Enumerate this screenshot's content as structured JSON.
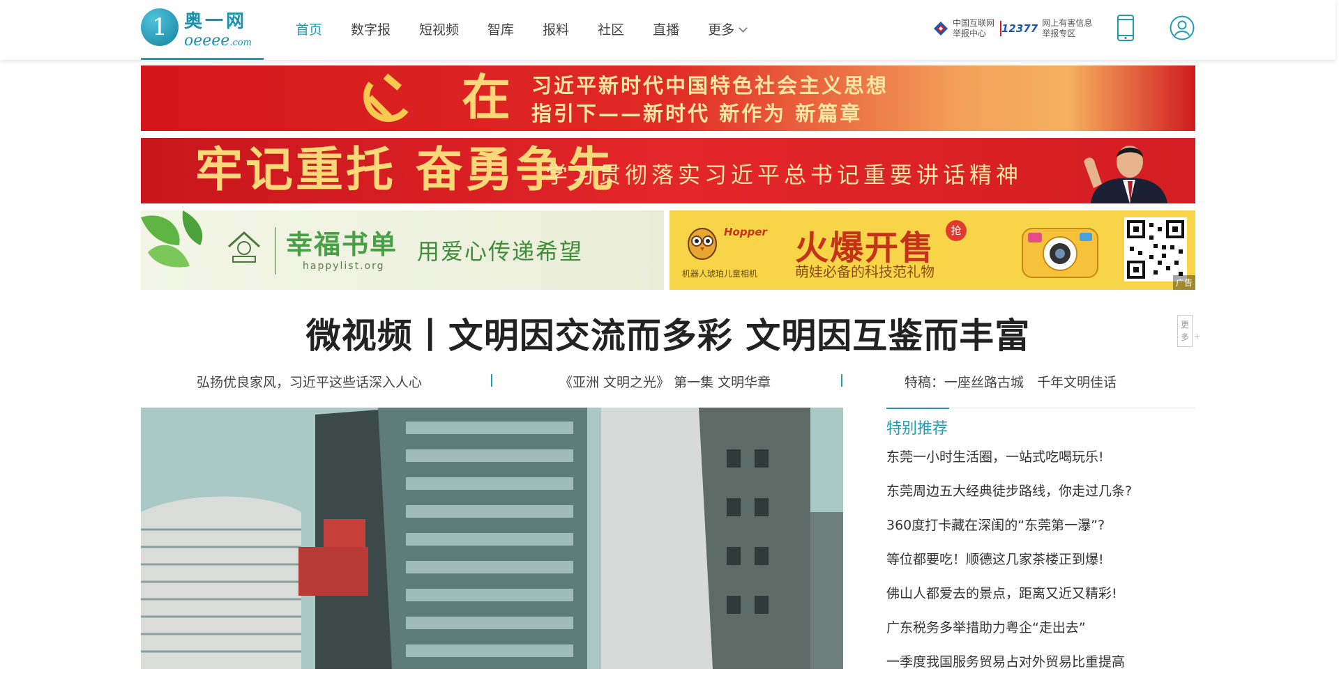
{
  "logo": {
    "cn": "奥一网",
    "en": "oeeee",
    "en_suffix": ".com"
  },
  "nav": [
    {
      "label": "首页",
      "active": true
    },
    {
      "label": "数字报"
    },
    {
      "label": "短视频"
    },
    {
      "label": "智库"
    },
    {
      "label": "报料"
    },
    {
      "label": "社区"
    },
    {
      "label": "直播"
    },
    {
      "label": "更多"
    }
  ],
  "report_links": [
    {
      "line1": "中国互联网",
      "line2": "举报中心"
    },
    {
      "prefix": "12377",
      "line1": "网上有害信息",
      "line2": "举报专区"
    }
  ],
  "banners": {
    "b1_big": "在",
    "b1_line1": "习近平新时代中国特色社会主义思想",
    "b1_line2": "指引下——新时代 新作为 新篇章",
    "b2_big": "牢记重托 奋勇争先",
    "b2_text": "学习贯彻落实习近平总书记重要讲话精神",
    "b3_title": "幸福书单",
    "b3_url": "happylist.org",
    "b3_slogan": "用爱心传递希望",
    "b4_brand": "Hopper",
    "b4_sub": "机器人琥珀儿童相机",
    "b4_title": "火爆开售",
    "b4_badge": "抢",
    "b4_slogan": "萌娃必备的科技范礼物",
    "ad_tag": "广告"
  },
  "headline": "微视频丨文明因交流而多彩 文明因互鉴而丰富",
  "more_btn": "更多",
  "sublinks": [
    "弘扬优良家风，习近平这些话深入人心",
    "《亚洲 文明之光》 第一集 文明华章",
    "特稿：一座丝路古城　千年文明佳话"
  ],
  "recommend": {
    "title": "特别推荐",
    "items": [
      "东莞一小时生活圈，一站式吃喝玩乐!",
      "东莞周边五大经典徒步路线，你走过几条?",
      "360度打卡藏在深闺的“东莞第一瀑”?",
      "等位都要吃！顺德这几家茶楼正到爆!",
      "佛山人都爱去的景点，距离又近又精彩!",
      "广东税务多举措助力粤企“走出去”",
      "一季度我国服务贸易占对外贸易比重提高"
    ]
  },
  "colors": {
    "accent": "#1f9bb6",
    "banner_red": "#d3161c",
    "banner_yellow": "#f7d448"
  }
}
